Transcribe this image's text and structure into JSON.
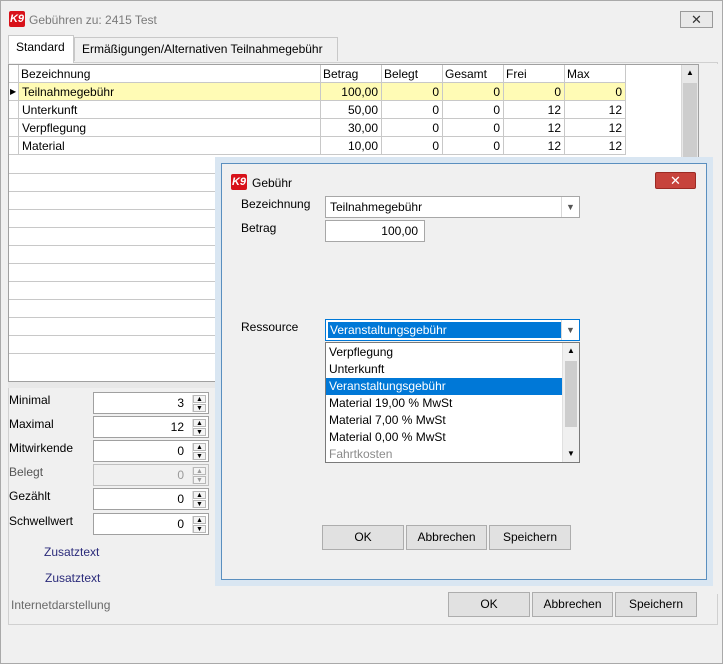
{
  "window": {
    "title": "Gebühren zu: 2415 Test",
    "close_label": "✕",
    "logo": "K9"
  },
  "tabs": [
    {
      "label": "Standard"
    },
    {
      "label": "Ermäßigungen/Alternativen Teilnahmegebühr"
    }
  ],
  "grid": {
    "columns": [
      "Bezeichnung",
      "Betrag",
      "Belegt",
      "Gesamt",
      "Frei",
      "Max"
    ],
    "rows": [
      [
        "Teilnahmegebühr",
        "100,00",
        "0",
        "0",
        "0",
        "0"
      ],
      [
        "Unterkunft",
        "50,00",
        "0",
        "0",
        "12",
        "12"
      ],
      [
        "Verpflegung",
        "30,00",
        "0",
        "0",
        "12",
        "12"
      ],
      [
        "Material",
        "10,00",
        "0",
        "0",
        "12",
        "12"
      ]
    ]
  },
  "fields": {
    "minimal": {
      "label": "Minimal",
      "value": "3"
    },
    "maximal": {
      "label": "Maximal",
      "value": "12"
    },
    "mitwirkende": {
      "label": "Mitwirkende",
      "value": "0"
    },
    "belegt": {
      "label": "Belegt",
      "value": "0"
    },
    "gezaehlt": {
      "label": "Gezählt",
      "value": "0"
    },
    "schwellwert": {
      "label": "Schwellwert",
      "value": "0"
    }
  },
  "links": {
    "zusatztext1": "Zusatztext",
    "zusatztext2": "Zusatztext",
    "internet": "Internetdarstellung"
  },
  "buttons": {
    "ok": "OK",
    "abbrechen": "Abbrechen",
    "speichern": "Speichern"
  },
  "dialog": {
    "title": "Gebühr",
    "logo": "K9",
    "close_label": "✕",
    "bezeichnung_label": "Bezeichnung",
    "bezeichnung_value": "Teilnahmegebühr",
    "betrag_label": "Betrag",
    "betrag_value": "100,00",
    "ressource_label": "Ressource",
    "ressource_value": "Veranstaltungsgebühr",
    "options": [
      "Verpflegung",
      "Unterkunft",
      "Veranstaltungsgebühr",
      "Material 19,00 % MwSt",
      "Material 7,00 % MwSt",
      "Material 0,00 % MwSt",
      "Fahrtkosten"
    ],
    "buttons": {
      "ok": "OK",
      "abbrechen": "Abbrechen",
      "speichern": "Speichern"
    }
  },
  "colors": {
    "selected_row": "#fffbb5",
    "highlight": "#0078d7",
    "dialog_close": "#c7433c",
    "logo": "#d8121a"
  }
}
